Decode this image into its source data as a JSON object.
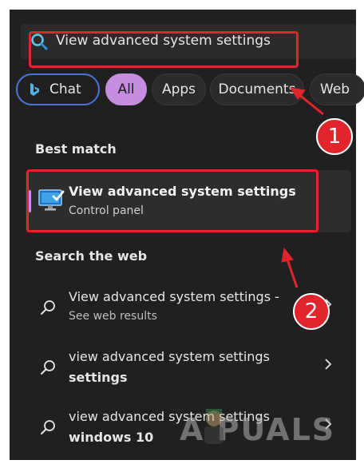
{
  "search": {
    "value": "View advanced system settings"
  },
  "filters": {
    "chat": "Chat",
    "all": "All",
    "apps": "Apps",
    "documents": "Documents",
    "web": "Web"
  },
  "best_match": {
    "heading": "Best match",
    "title": "View advanced system settings",
    "subtitle": "Control panel",
    "icon": "monitor-checkmark-icon"
  },
  "web_search": {
    "heading": "Search the web",
    "results": [
      {
        "line1": "View advanced system settings -",
        "line2": "See web results"
      },
      {
        "line1": "view advanced system settings",
        "line2": "settings"
      },
      {
        "line1": "view advanced system settings",
        "line2": "windows 10"
      }
    ]
  },
  "annotations": {
    "step1": "1",
    "step2": "2"
  },
  "watermark": "A PUALS",
  "colors": {
    "panel_bg": "#202020",
    "accent_purple": "#c58ce0",
    "highlight_red": "#e0252d",
    "chat_border": "#4a73d8"
  }
}
